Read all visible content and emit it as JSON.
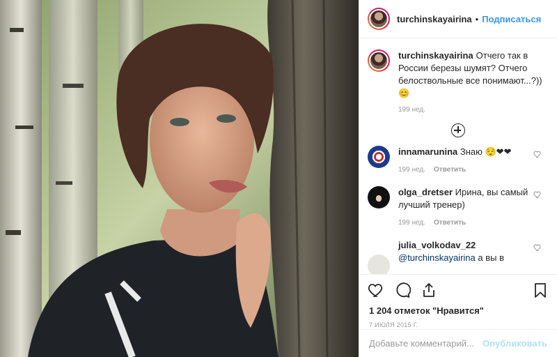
{
  "header": {
    "username": "turchinskayairina",
    "separator": "•",
    "follow_label": "Подписаться"
  },
  "caption": {
    "username": "turchinskayairina",
    "text": "Отчего так в России березы шумят? Отчего белоствольные все понимают...?))😊",
    "time": "199 нед."
  },
  "comments": [
    {
      "username": "innamarunina",
      "text": "Знаю 😌❤❤",
      "time": "199 нед.",
      "reply": "Ответить"
    },
    {
      "username": "olga_dretser",
      "text": "Ирина, вы самый лучший тренер)",
      "time": "199 нед.",
      "reply": "Ответить"
    },
    {
      "username": "julia_volkodav_22",
      "mention": "@turchinskayairina",
      "text": "а вы в"
    }
  ],
  "likes": "1 204 отметок \"Нравится\"",
  "date": "7 ИЮЛЯ 2015 Г.",
  "add_comment": {
    "placeholder": "Добавьте комментарий...",
    "publish_label": "Опубликовать"
  },
  "colors": {
    "link": "#3897f0",
    "muted": "#999999",
    "publish_disabled": "#b2dffc"
  }
}
